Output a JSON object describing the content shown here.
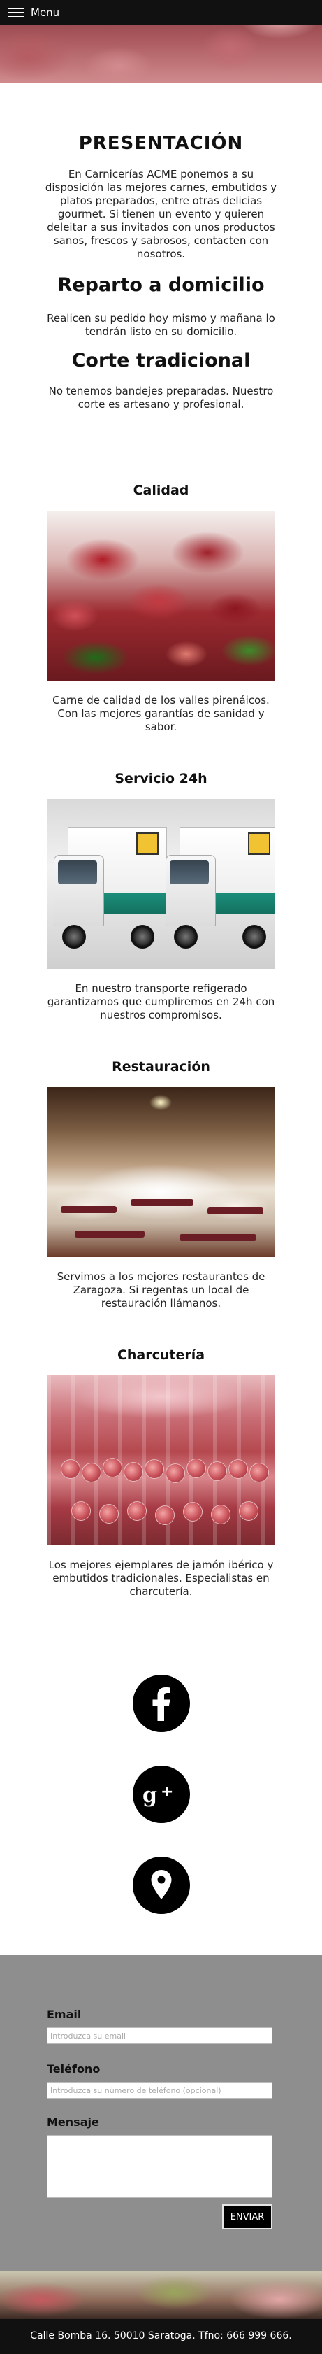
{
  "nav": {
    "menu_label": "Menu"
  },
  "intro": {
    "title": "PRESENTACIÓN",
    "text": "En Carnicerías ACME ponemos a su disposición las mejores carnes, embutidos y platos preparados, entre otras delicias gourmet. Si tienen un evento y quieren deleitar a sus invitados con unos productos sanos, frescos y sabrosos, contacten con nosotros."
  },
  "reparto": {
    "title": "Reparto a domicilio",
    "text": "Realicen su pedido hoy mismo y mañana lo tendrán listo en su domicilio."
  },
  "corte": {
    "title": "Corte tradicional",
    "text": "No tenemos bandejes preparadas. Nuestro corte es artesano y profesional."
  },
  "services": [
    {
      "title": "Calidad",
      "text": "Carne de calidad de los valles pirenáicos. Con las mejores garantías de sanidad y sabor.",
      "image": "meat-photo"
    },
    {
      "title": "Servicio 24h",
      "text": "En nuestro transporte refigerado garantizamos que cumpliremos en 24h con nuestros compromisos.",
      "image": "trucks-photo"
    },
    {
      "title": "Restauración",
      "text": "Servimos a los mejores restaurantes de Zaragoza. Si regentas un local de restauración llámanos.",
      "image": "restaurant-photo"
    },
    {
      "title": "Charcutería",
      "text": "Los mejores ejemplares de jamón ibérico y embutidos tradicionales. Especialistas en charcutería.",
      "image": "deli-photo"
    }
  ],
  "social": [
    {
      "icon": "facebook-icon"
    },
    {
      "icon": "google-plus-icon"
    },
    {
      "icon": "map-pin-icon"
    }
  ],
  "form": {
    "email_label": "Email",
    "email_placeholder": "Introduzca su email",
    "phone_label": "Teléfono",
    "phone_placeholder": "Introduzca su número de teléfono (opcional)",
    "message_label": "Mensaje",
    "send_label": "ENVIAR"
  },
  "footer": {
    "text": "Calle Bomba 16. 50010 Saratoga. Tfno: 666 999 666."
  },
  "colors": {
    "navbar": "#111111",
    "contact_bg": "#8e8e8e",
    "button_bg": "#000000",
    "footer_bg": "#111111"
  }
}
